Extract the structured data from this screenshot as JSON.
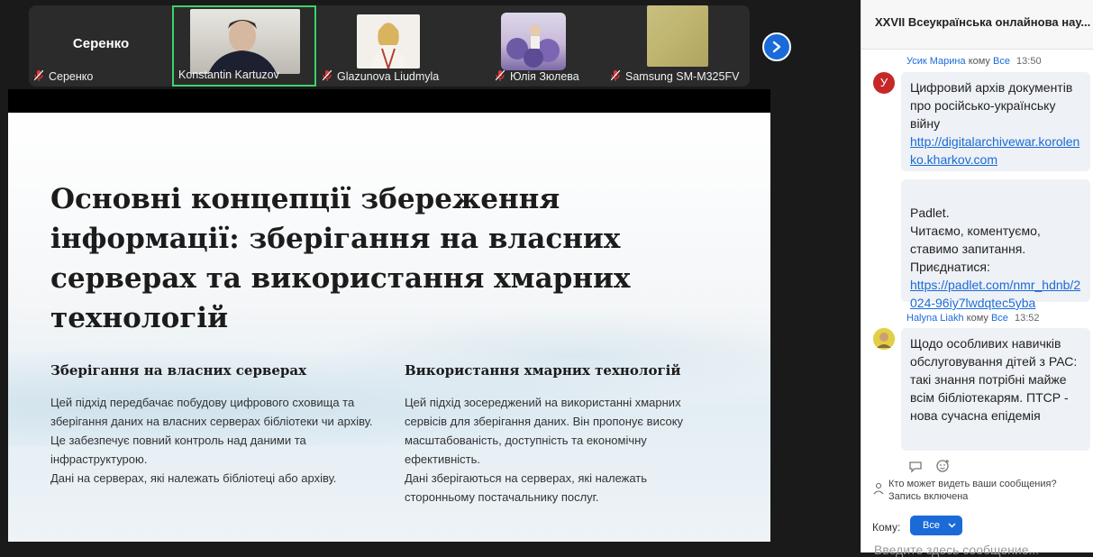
{
  "participants": [
    {
      "name": "Серенко",
      "big_name": "Серенко",
      "muted": true
    },
    {
      "name": "Konstantin Kartuzov",
      "muted": false,
      "active": true
    },
    {
      "name": "Glazunova Liudmyla",
      "muted": true
    },
    {
      "name": "Юлія Зюлева",
      "muted": true
    },
    {
      "name": "Samsung SM-M325FV",
      "muted": true
    }
  ],
  "slide": {
    "title": "Основні концепції збереження інформації: зберігання на власних серверах та використання хмарних технологій",
    "left_heading": "Зберігання на власних серверах",
    "left_text": "Цей підхід передбачає побудову цифрового сховища та зберігання даних на власних серверах бібліотеки чи архіву. Це забезпечує повний контроль над даними та інфраструктурою.\nДані на серверах, які належать бібліотеці або архіву.",
    "right_heading": "Використання хмарних технологій",
    "right_text": "Цей підхід зосереджений на використанні хмарних сервісів для зберігання даних. Він пропонує високу масштабованість, доступність та економічну ефективність.\nДані зберігаються на серверах, які належать сторонньому постачальнику послуг."
  },
  "chat": {
    "title": "XXVII Всеукраїнська онлайнова нау...",
    "messages": [
      {
        "sender": "Усик Марина",
        "to_word": "кому",
        "to": "Все",
        "time": "13:50",
        "avatar_letter": "У",
        "avatar_color": "#c62828",
        "bubbles": [
          {
            "text": "Цифровий архів документів про російсько-українську війну",
            "link": "http://digitalarchivewar.korolenko.kharkov.com"
          },
          {
            "text": "Padlet.\nЧитаємо, коментуємо, ставимо запитання.\nПриєднатися:",
            "link": "https://padlet.com/nmr_hdnb/2024-96iy7lwdqtec5yba"
          }
        ]
      },
      {
        "sender": "Halyna Liakh",
        "to_word": "кому",
        "to": "Все",
        "time": "13:52",
        "bubbles": [
          {
            "text": " Щодо особливих навичків обслуговування дітей з РАС: такі знання потрібні майже всім бібліотекарям. ПТСР - нова сучасна епідемія"
          }
        ]
      }
    ],
    "who_sees": "Кто может видеть ваши сообщения? Запись включена",
    "to_label": "Кому:",
    "to_value": "Все",
    "input_placeholder": "Введите здесь сообщение..."
  },
  "colors": {
    "accent": "#1a6bd8",
    "active_tile_border": "#3fd26b",
    "muted_mic": "#e53935"
  }
}
